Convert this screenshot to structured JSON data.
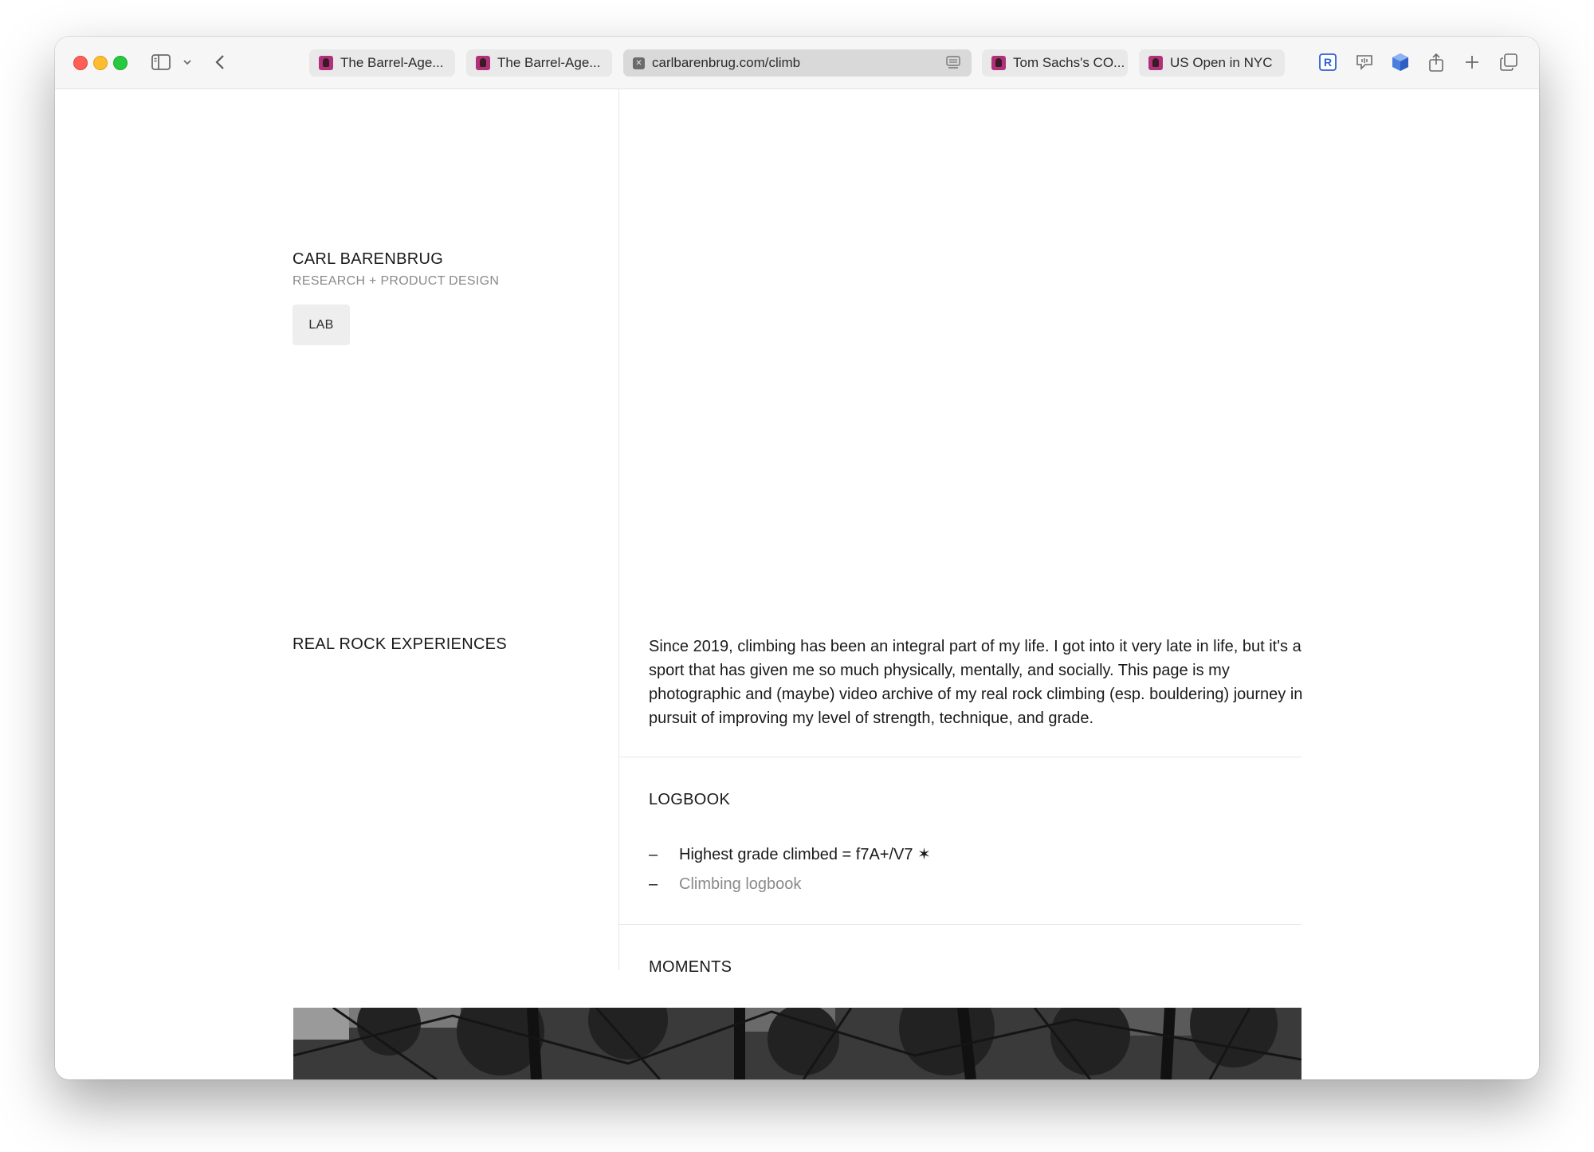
{
  "browser": {
    "tabs": [
      {
        "title": "The Barrel-Age...",
        "active": false,
        "favicon": "portrait-favicon"
      },
      {
        "title": "The Barrel-Age...",
        "active": false,
        "favicon": "portrait-favicon"
      },
      {
        "title": "carlbarenbrug.com/climb",
        "active": true,
        "favicon": "site-favicon"
      },
      {
        "title": "Tom Sachs's CO...",
        "active": false,
        "favicon": "portrait-favicon"
      },
      {
        "title": "US Open in NYC",
        "active": false,
        "favicon": "portrait-favicon"
      }
    ],
    "toolbar_icons": [
      "sidebar-icon",
      "chevron-down-icon",
      "back-icon",
      "reader-icon",
      "r-extension-icon",
      "speech-extension-icon",
      "cube-extension-icon",
      "share-icon",
      "new-tab-icon",
      "tab-overview-icon"
    ]
  },
  "page": {
    "name": "CARL BARENBRUG",
    "subtitle": "RESEARCH + PRODUCT DESIGN",
    "lab_label": "LAB",
    "section_title": "REAL ROCK EXPERIENCES",
    "intro": "Since 2019, climbing has been an integral part of my life. I got into it very late in life, but it's a sport that has given me so much physically, mentally, and socially. This page is my photographic and (maybe) video archive of my real rock climbing (esp. bouldering) journey in pursuit of improving my level of strength, technique, and grade.",
    "logbook": {
      "title": "LOGBOOK",
      "items": [
        {
          "dash": "–",
          "text": "Highest grade climbed = f7A+/V7 ✶"
        },
        {
          "dash": "–",
          "text": "Climbing logbook"
        }
      ]
    },
    "moments_title": "MOMENTS"
  },
  "colors": {
    "text": "#1a1a1a",
    "muted": "#8a8a8a",
    "button_bg": "#eeeeee",
    "divider": "#e6e6e6"
  }
}
